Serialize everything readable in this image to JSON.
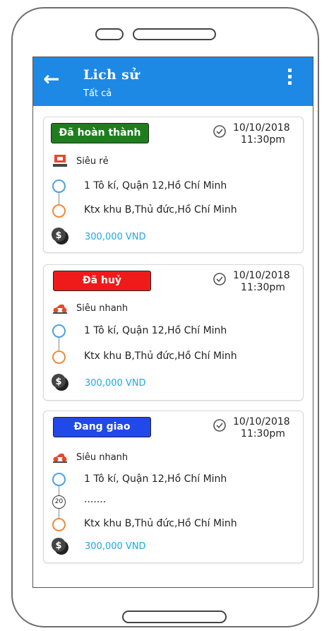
{
  "app_bar": {
    "back_icon": "arrow-left-icon",
    "title": "Lich sử",
    "subtitle": "Tất cả",
    "menu_icon": "more-vertical-icon",
    "color": "#1e88e5"
  },
  "orders": [
    {
      "status": "Đã hoàn thành",
      "status_color": "#1e7e1e",
      "date": "10/10/2018",
      "time": "11:30pm",
      "service": "Siêu rẻ",
      "service_icon": "cheap-service-icon",
      "pickup": "1 Tô kí, Quận 12,Hồ Chí Minh",
      "dropoff": "Ktx khu B,Thủ đức,Hồ Chí Minh",
      "price": "300,000 VND"
    },
    {
      "status": "Đã huỷ",
      "status_color": "#ef1b1b",
      "date": "10/10/2018",
      "time": "11:30pm",
      "service": "Siêu nhanh",
      "service_icon": "motorbike-icon",
      "pickup": "1 Tô kí, Quận 12,Hồ Chí Minh",
      "dropoff": "Ktx khu B,Thủ đức,Hồ Chí Minh",
      "price": "300,000 VND"
    },
    {
      "status": "Đang giao",
      "status_color": "#2148e8",
      "date": "10/10/2018",
      "time": "11:30pm",
      "service": "Siêu nhanh",
      "service_icon": "motorbike-icon",
      "pickup": "1 Tô kí, Quận 12,Hồ Chí Minh",
      "stops_count": "20",
      "stops_more": ".......",
      "dropoff": "Ktx khu B,Thủ đức,Hồ Chí Minh",
      "price": "300,000 VND"
    }
  ]
}
